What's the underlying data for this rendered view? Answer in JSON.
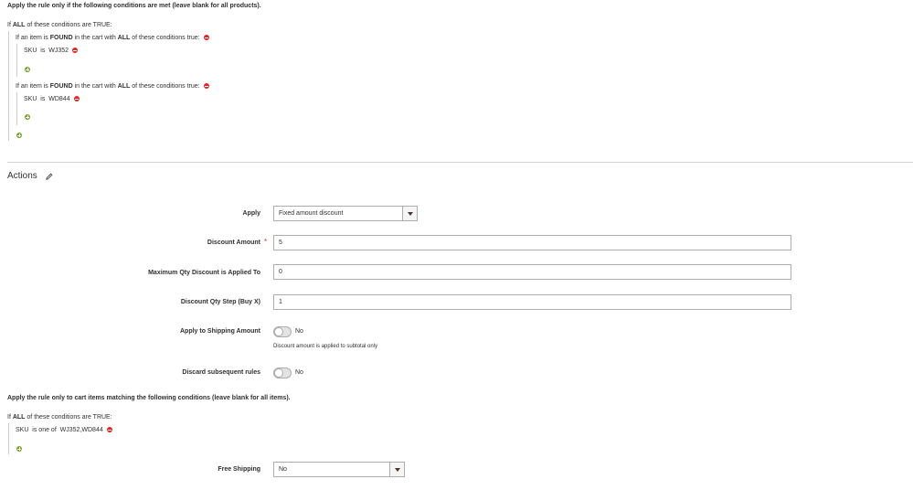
{
  "conditions": {
    "intro": "Apply the rule only if the following conditions are met (leave blank for all products).",
    "root": {
      "if": "If",
      "aggregator": "ALL",
      "middle": "of these conditions are",
      "value": "TRUE",
      "suffix": ":"
    },
    "found_1": {
      "prefix": "If an item is",
      "found": "FOUND",
      "mid": "in the cart with",
      "aggregator": "ALL",
      "suffix": "of these conditions true:"
    },
    "sku_1": {
      "attr": "SKU",
      "op": "is",
      "value": "WJ352"
    },
    "found_2": {
      "prefix": "If an item is",
      "found": "FOUND",
      "mid": "in the cart with",
      "aggregator": "ALL",
      "suffix": "of these conditions true:"
    },
    "sku_2": {
      "attr": "SKU",
      "op": "is",
      "value": "WD844"
    }
  },
  "actions": {
    "title": "Actions",
    "apply": {
      "label": "Apply",
      "value": "Fixed amount discount"
    },
    "discount_amount": {
      "label": "Discount Amount",
      "required": "*",
      "value": "5"
    },
    "max_qty": {
      "label": "Maximum Qty Discount is Applied To",
      "value": "0"
    },
    "qty_step": {
      "label": "Discount Qty Step (Buy X)",
      "value": "1"
    },
    "apply_shipping": {
      "label": "Apply to Shipping Amount",
      "state": "No",
      "note": "Discount amount is applied to subtotal only"
    },
    "discard_rules": {
      "label": "Discard subsequent rules",
      "state": "No"
    },
    "items_intro": "Apply the rule only to cart items matching the following conditions (leave blank for all items).",
    "items_root": {
      "if": "If",
      "aggregator": "ALL",
      "middle": "of these conditions are",
      "value": "TRUE",
      "suffix": ":"
    },
    "items_sku": {
      "attr": "SKU",
      "op": "is one of",
      "value": "WJ352,WD844"
    },
    "free_shipping": {
      "label": "Free Shipping",
      "value": "No"
    }
  },
  "colors": {
    "remove": "#e22626",
    "add": "#79a22e",
    "required": "#e02b27",
    "border": "#adadad"
  }
}
